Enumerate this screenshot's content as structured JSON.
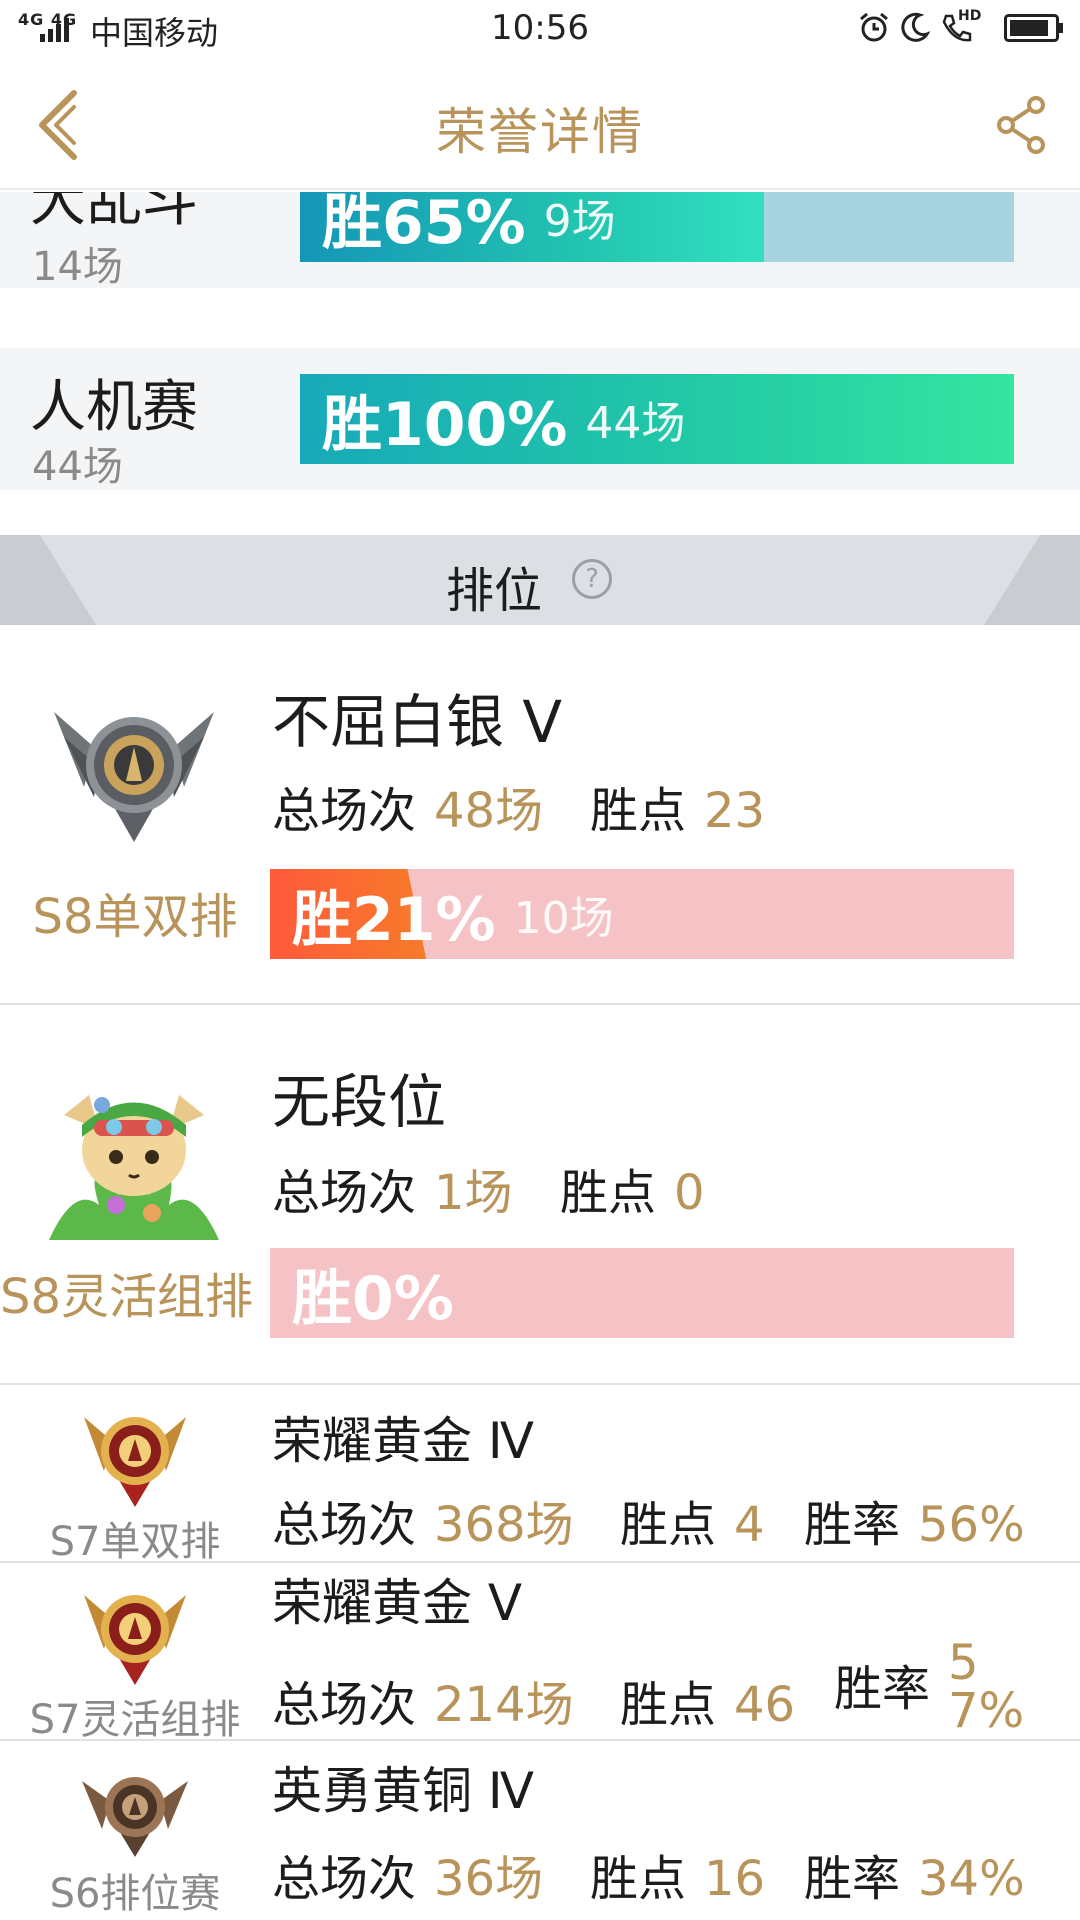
{
  "status_bar": {
    "signal": "4G 4G",
    "carrier": "中国移动",
    "time": "10:56",
    "call_hd": "HD"
  },
  "header": {
    "title": "荣誉详情"
  },
  "modes": [
    {
      "name": "大乱斗",
      "games": "14场",
      "win_label": "胜65%",
      "win_games": "9场",
      "win_rate": 0.65
    },
    {
      "name": "人机赛",
      "games": "44场",
      "win_label": "胜100%",
      "win_games": "44场",
      "win_rate": 1.0
    }
  ],
  "ranked_section": {
    "title": "排位",
    "help_icon": "?"
  },
  "ranked_detailed": [
    {
      "season": "S8单双排",
      "rank": "不屈白银 V",
      "total_label": "总场次",
      "total": "48场",
      "points_label": "胜点",
      "points": "23",
      "win_label": "胜21%",
      "win_games": "10场",
      "win_rate": 0.21
    },
    {
      "season": "S8灵活组排",
      "rank": "无段位",
      "total_label": "总场次",
      "total": "1场",
      "points_label": "胜点",
      "points": "0",
      "win_label": "胜0%",
      "win_games": "",
      "win_rate": 0.0
    }
  ],
  "ranked_history": [
    {
      "season": "S7单双排",
      "rank": "荣耀黄金 Ⅳ",
      "total_label": "总场次",
      "total": "368场",
      "points_label": "胜点",
      "points": "4",
      "rate_label": "胜率",
      "rate": "56%"
    },
    {
      "season": "S7灵活组排",
      "rank": "荣耀黄金 V",
      "total_label": "总场次",
      "total": "214场",
      "points_label": "胜点",
      "points": "46",
      "rate_label": "胜率",
      "rate": "57%"
    },
    {
      "season": "S6排位赛",
      "rank": "英勇黄铜 Ⅳ",
      "total_label": "总场次",
      "total": "36场",
      "points_label": "胜点",
      "points": "16",
      "rate_label": "胜率",
      "rate": "34%"
    }
  ],
  "colors": {
    "gold": "#b8935a",
    "teal_fill": "#20c9a6",
    "teal_track": "#a8d4e0",
    "red_fill": "#f5522e",
    "pink_track": "#f5c2c6",
    "section_bg": "#dce0e4"
  },
  "icons": [
    "back-arrow-icon",
    "share-icon",
    "help-icon",
    "alarm-icon",
    "moon-icon",
    "call-icon",
    "battery-icon",
    "silver-emblem-icon",
    "teemo-avatar-icon",
    "gold-emblem-icon",
    "bronze-emblem-icon"
  ]
}
